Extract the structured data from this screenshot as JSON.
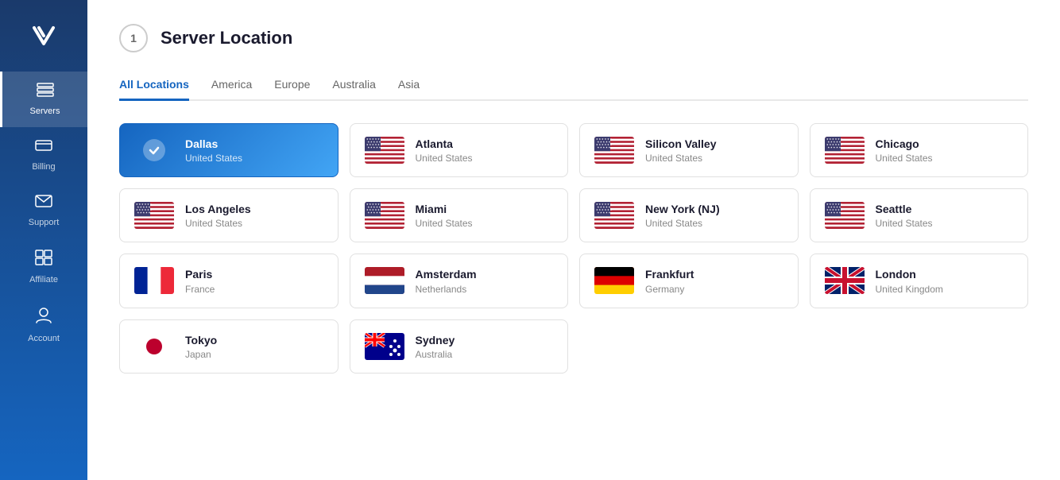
{
  "sidebar": {
    "logo_text": "V",
    "items": [
      {
        "id": "servers",
        "label": "Servers",
        "icon": "☰",
        "active": true
      },
      {
        "id": "billing",
        "label": "Billing",
        "icon": "💳",
        "active": false
      },
      {
        "id": "support",
        "label": "Support",
        "icon": "✉",
        "active": false
      },
      {
        "id": "affiliate",
        "label": "Affiliate",
        "icon": "⊞",
        "active": false
      },
      {
        "id": "account",
        "label": "Account",
        "icon": "👤",
        "active": false
      }
    ]
  },
  "page": {
    "step": "1",
    "title": "Server Location"
  },
  "tabs": [
    {
      "id": "all",
      "label": "All Locations",
      "active": true
    },
    {
      "id": "america",
      "label": "America",
      "active": false
    },
    {
      "id": "europe",
      "label": "Europe",
      "active": false
    },
    {
      "id": "australia",
      "label": "Australia",
      "active": false
    },
    {
      "id": "asia",
      "label": "Asia",
      "active": false
    }
  ],
  "locations": [
    {
      "id": "dallas",
      "name": "Dallas",
      "country": "United States",
      "flag": "us",
      "selected": true
    },
    {
      "id": "atlanta",
      "name": "Atlanta",
      "country": "United States",
      "flag": "us",
      "selected": false
    },
    {
      "id": "silicon-valley",
      "name": "Silicon Valley",
      "country": "United States",
      "flag": "us",
      "selected": false
    },
    {
      "id": "chicago",
      "name": "Chicago",
      "country": "United States",
      "flag": "us",
      "selected": false
    },
    {
      "id": "los-angeles",
      "name": "Los Angeles",
      "country": "United States",
      "flag": "us",
      "selected": false
    },
    {
      "id": "miami",
      "name": "Miami",
      "country": "United States",
      "flag": "us",
      "selected": false
    },
    {
      "id": "new-york",
      "name": "New York (NJ)",
      "country": "United States",
      "flag": "us",
      "selected": false
    },
    {
      "id": "seattle",
      "name": "Seattle",
      "country": "United States",
      "flag": "us",
      "selected": false
    },
    {
      "id": "paris",
      "name": "Paris",
      "country": "France",
      "flag": "fr",
      "selected": false
    },
    {
      "id": "amsterdam",
      "name": "Amsterdam",
      "country": "Netherlands",
      "flag": "nl",
      "selected": false
    },
    {
      "id": "frankfurt",
      "name": "Frankfurt",
      "country": "Germany",
      "flag": "de",
      "selected": false
    },
    {
      "id": "london",
      "name": "London",
      "country": "United Kingdom",
      "flag": "gb",
      "selected": false
    },
    {
      "id": "tokyo",
      "name": "Tokyo",
      "country": "Japan",
      "flag": "jp",
      "selected": false
    },
    {
      "id": "sydney",
      "name": "Sydney",
      "country": "Australia",
      "flag": "au",
      "selected": false
    }
  ]
}
